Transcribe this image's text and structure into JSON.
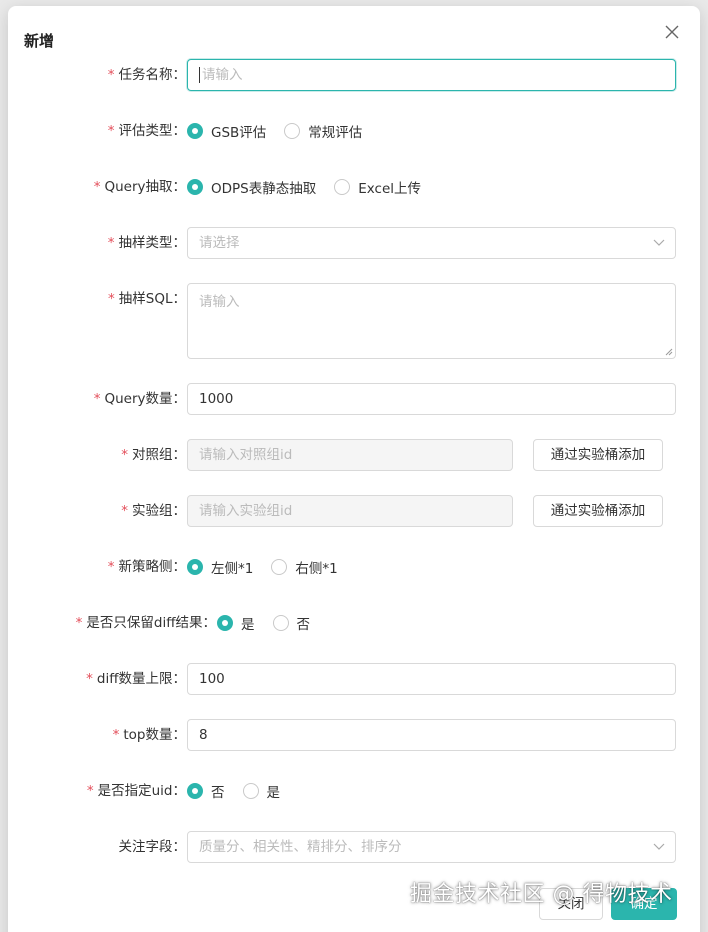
{
  "modal": {
    "title": "新增",
    "close_icon": "close-icon"
  },
  "form": {
    "task_name": {
      "label": "任务名称",
      "placeholder": "请输入",
      "value": ""
    },
    "eval_type": {
      "label": "评估类型",
      "options": [
        "GSB评估",
        "常规评估"
      ],
      "selected": "GSB评估"
    },
    "query_extract": {
      "label": "Query抽取",
      "options": [
        "ODPS表静态抽取",
        "Excel上传"
      ],
      "selected": "ODPS表静态抽取"
    },
    "sample_type": {
      "label": "抽样类型",
      "placeholder": "请选择"
    },
    "sample_sql": {
      "label": "抽样SQL",
      "placeholder": "请输入"
    },
    "query_count": {
      "label": "Query数量",
      "value": "1000"
    },
    "control_group": {
      "label": "对照组",
      "placeholder": "请输入对照组id",
      "button": "通过实验桶添加"
    },
    "experiment_group": {
      "label": "实验组",
      "placeholder": "请输入实验组id",
      "button": "通过实验桶添加"
    },
    "new_strategy_side": {
      "label": "新策略侧",
      "options": [
        "左侧*1",
        "右侧*1"
      ],
      "selected": "左侧*1"
    },
    "diff_only": {
      "label": "是否只保留diff结果",
      "options": [
        "是",
        "否"
      ],
      "selected": "是"
    },
    "diff_limit": {
      "label": "diff数量上限",
      "value": "100"
    },
    "top_count": {
      "label": "top数量",
      "value": "8"
    },
    "specify_uid": {
      "label": "是否指定uid",
      "options": [
        "否",
        "是"
      ],
      "selected": "否"
    },
    "focus_fields": {
      "label": "关注字段",
      "placeholder": "质量分、相关性、精排分、排序分"
    }
  },
  "footer": {
    "close_label": "关闭",
    "ok_label": "确定"
  },
  "watermark": "掘金技术社区 @ 得物技术",
  "colors": {
    "accent": "#2bb5ad",
    "required": "#e34d59"
  }
}
